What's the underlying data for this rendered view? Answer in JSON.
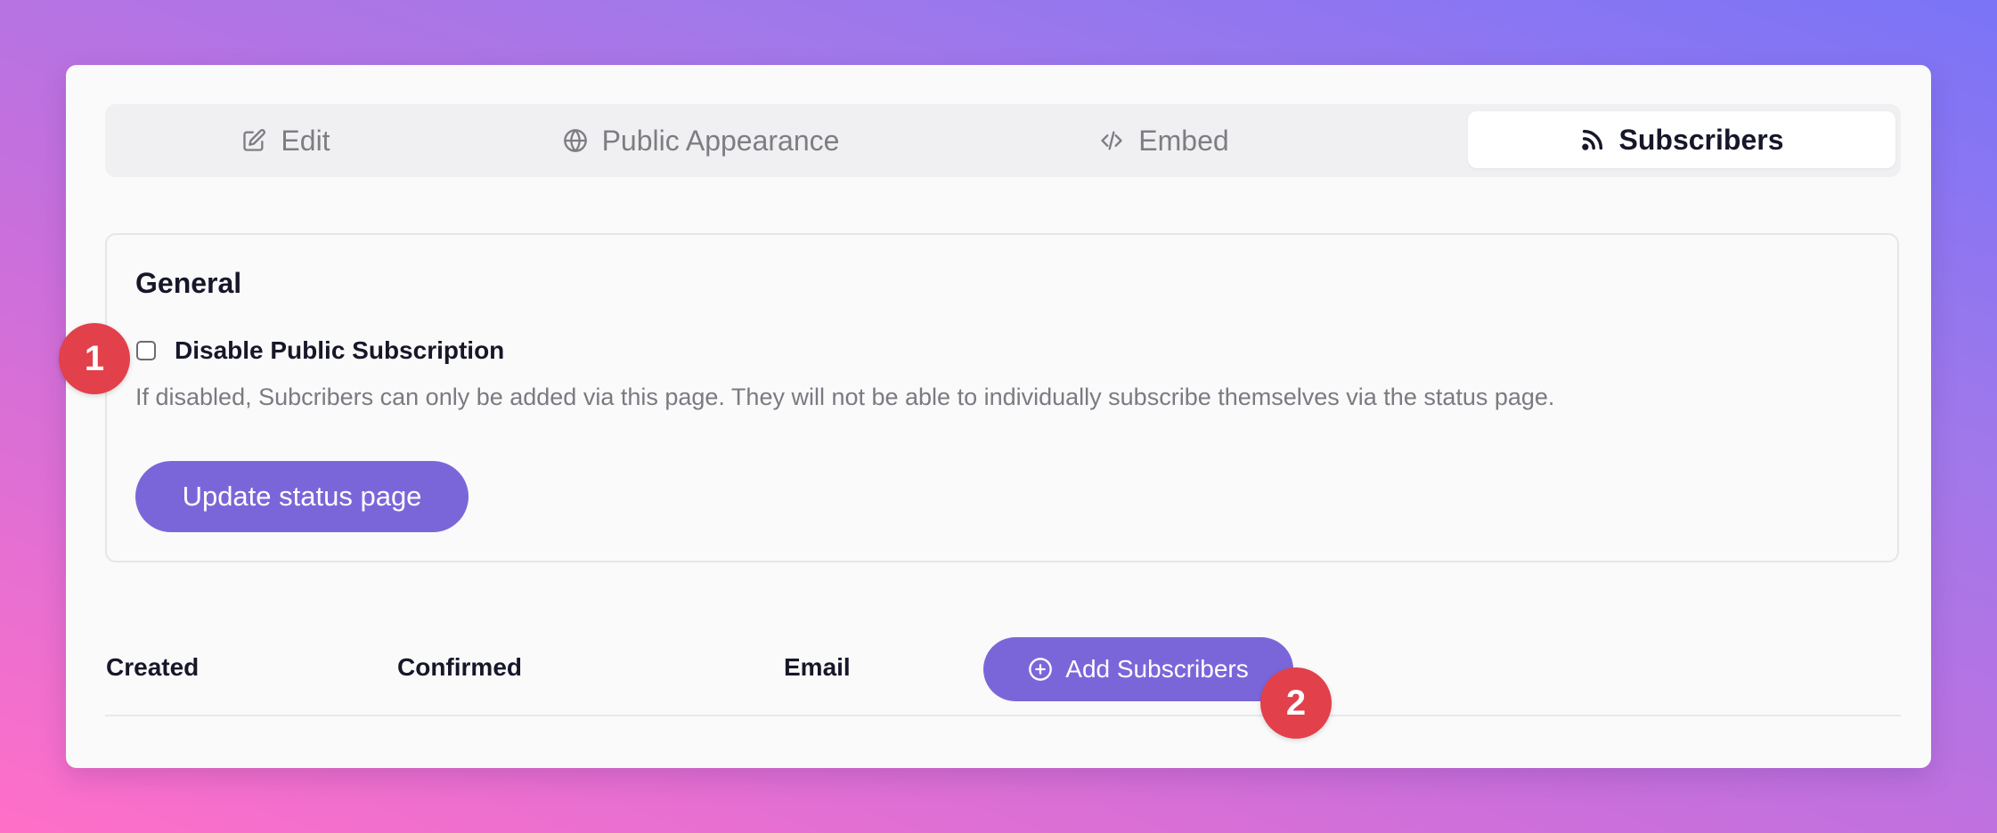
{
  "tabs": [
    {
      "label": "Edit",
      "icon": "edit-icon"
    },
    {
      "label": "Public Appearance",
      "icon": "globe-icon"
    },
    {
      "label": "Embed",
      "icon": "code-icon"
    },
    {
      "label": "Subscribers",
      "icon": "rss-icon",
      "active": true
    }
  ],
  "general": {
    "title": "General",
    "disable_label": "Disable Public Subscription",
    "disable_checked": false,
    "help_text": "If disabled, Subcribers can only be added via this page. They will not be able to individually subscribe themselves via the status page.",
    "update_button": "Update status page"
  },
  "table": {
    "columns": [
      "Created",
      "Confirmed",
      "Email"
    ],
    "add_button": "Add Subscribers"
  },
  "annotations": [
    "1",
    "2"
  ],
  "colors": {
    "accent": "#7b66d9",
    "badge": "#e2404a"
  }
}
